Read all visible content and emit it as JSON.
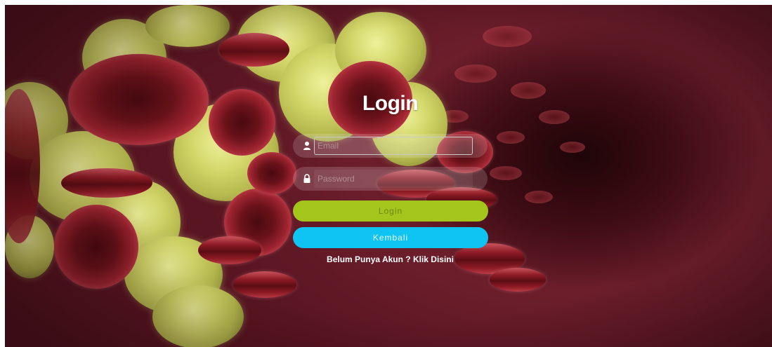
{
  "page": {
    "title": "Login"
  },
  "form": {
    "username": {
      "value": "",
      "placeholder": "Email",
      "icon": "user-icon"
    },
    "password": {
      "value": "",
      "placeholder": "Password",
      "icon": "lock-icon"
    },
    "login_label": "Login",
    "back_label": "Kembali",
    "signup_text": "Belum Punya Akun ? Klik Disini"
  },
  "colors": {
    "login_button": "#a4c51c",
    "back_button": "#0fc3f3",
    "background": "#5b1622"
  }
}
